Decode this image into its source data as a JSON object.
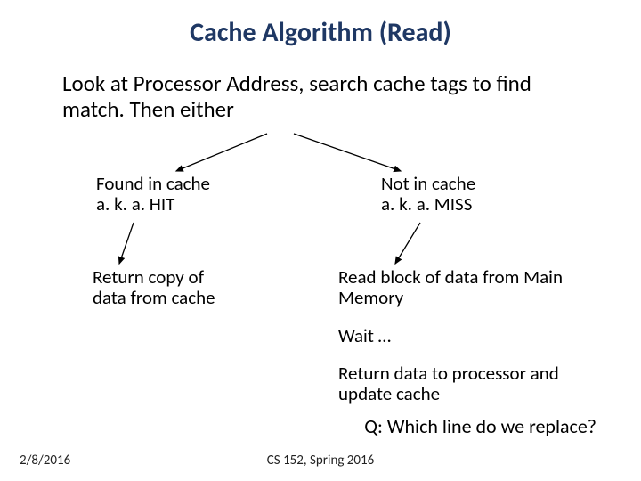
{
  "title": "Cache Algorithm (Read)",
  "intro": "Look at Processor Address, search cache tags to find match.  Then either",
  "hit": {
    "line1": "Found in cache",
    "line2": "a. k. a.  HIT"
  },
  "miss": {
    "line1": "Not in cache",
    "line2": "a. k. a. MISS"
  },
  "hit_action": "Return copy of data from cache",
  "miss_actions": {
    "a1": "Read block of data from Main Memory",
    "a2": "Wait …",
    "a3": "Return data to processor and update cache"
  },
  "question": "Q: Which line do we replace?",
  "footer": {
    "date": "2/8/2016",
    "center": "CS 152, Spring 2016"
  }
}
